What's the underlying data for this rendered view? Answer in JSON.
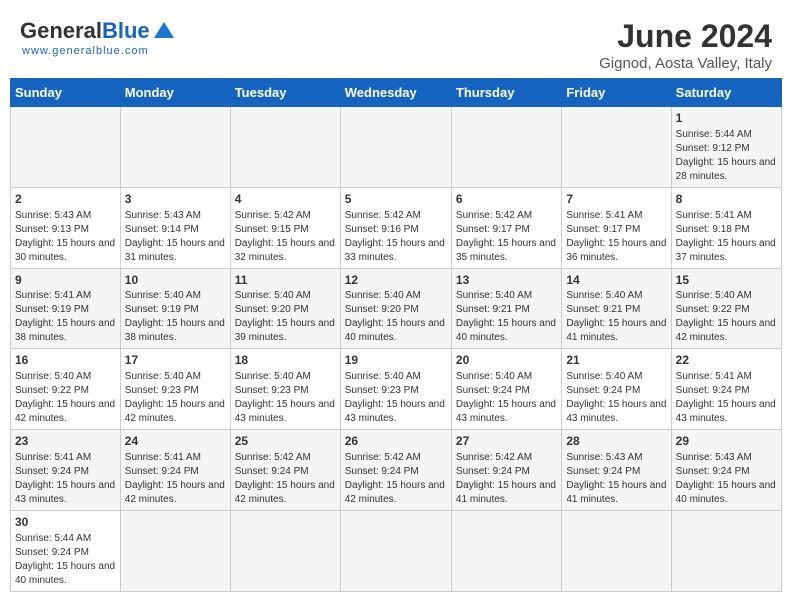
{
  "header": {
    "logo_general": "General",
    "logo_blue": "Blue",
    "logo_tagline": "www.generalblue.com",
    "month_title": "June 2024",
    "location": "Gignod, Aosta Valley, Italy"
  },
  "weekdays": [
    "Sunday",
    "Monday",
    "Tuesday",
    "Wednesday",
    "Thursday",
    "Friday",
    "Saturday"
  ],
  "days": {
    "d1": {
      "num": "1",
      "sunrise": "5:44 AM",
      "sunset": "9:12 PM",
      "daylight": "15 hours and 28 minutes."
    },
    "d2": {
      "num": "2",
      "sunrise": "5:43 AM",
      "sunset": "9:13 PM",
      "daylight": "15 hours and 30 minutes."
    },
    "d3": {
      "num": "3",
      "sunrise": "5:43 AM",
      "sunset": "9:14 PM",
      "daylight": "15 hours and 31 minutes."
    },
    "d4": {
      "num": "4",
      "sunrise": "5:42 AM",
      "sunset": "9:15 PM",
      "daylight": "15 hours and 32 minutes."
    },
    "d5": {
      "num": "5",
      "sunrise": "5:42 AM",
      "sunset": "9:16 PM",
      "daylight": "15 hours and 33 minutes."
    },
    "d6": {
      "num": "6",
      "sunrise": "5:42 AM",
      "sunset": "9:17 PM",
      "daylight": "15 hours and 35 minutes."
    },
    "d7": {
      "num": "7",
      "sunrise": "5:41 AM",
      "sunset": "9:17 PM",
      "daylight": "15 hours and 36 minutes."
    },
    "d8": {
      "num": "8",
      "sunrise": "5:41 AM",
      "sunset": "9:18 PM",
      "daylight": "15 hours and 37 minutes."
    },
    "d9": {
      "num": "9",
      "sunrise": "5:41 AM",
      "sunset": "9:19 PM",
      "daylight": "15 hours and 38 minutes."
    },
    "d10": {
      "num": "10",
      "sunrise": "5:40 AM",
      "sunset": "9:19 PM",
      "daylight": "15 hours and 38 minutes."
    },
    "d11": {
      "num": "11",
      "sunrise": "5:40 AM",
      "sunset": "9:20 PM",
      "daylight": "15 hours and 39 minutes."
    },
    "d12": {
      "num": "12",
      "sunrise": "5:40 AM",
      "sunset": "9:20 PM",
      "daylight": "15 hours and 40 minutes."
    },
    "d13": {
      "num": "13",
      "sunrise": "5:40 AM",
      "sunset": "9:21 PM",
      "daylight": "15 hours and 40 minutes."
    },
    "d14": {
      "num": "14",
      "sunrise": "5:40 AM",
      "sunset": "9:21 PM",
      "daylight": "15 hours and 41 minutes."
    },
    "d15": {
      "num": "15",
      "sunrise": "5:40 AM",
      "sunset": "9:22 PM",
      "daylight": "15 hours and 42 minutes."
    },
    "d16": {
      "num": "16",
      "sunrise": "5:40 AM",
      "sunset": "9:22 PM",
      "daylight": "15 hours and 42 minutes."
    },
    "d17": {
      "num": "17",
      "sunrise": "5:40 AM",
      "sunset": "9:23 PM",
      "daylight": "15 hours and 42 minutes."
    },
    "d18": {
      "num": "18",
      "sunrise": "5:40 AM",
      "sunset": "9:23 PM",
      "daylight": "15 hours and 43 minutes."
    },
    "d19": {
      "num": "19",
      "sunrise": "5:40 AM",
      "sunset": "9:23 PM",
      "daylight": "15 hours and 43 minutes."
    },
    "d20": {
      "num": "20",
      "sunrise": "5:40 AM",
      "sunset": "9:24 PM",
      "daylight": "15 hours and 43 minutes."
    },
    "d21": {
      "num": "21",
      "sunrise": "5:40 AM",
      "sunset": "9:24 PM",
      "daylight": "15 hours and 43 minutes."
    },
    "d22": {
      "num": "22",
      "sunrise": "5:41 AM",
      "sunset": "9:24 PM",
      "daylight": "15 hours and 43 minutes."
    },
    "d23": {
      "num": "23",
      "sunrise": "5:41 AM",
      "sunset": "9:24 PM",
      "daylight": "15 hours and 43 minutes."
    },
    "d24": {
      "num": "24",
      "sunrise": "5:41 AM",
      "sunset": "9:24 PM",
      "daylight": "15 hours and 42 minutes."
    },
    "d25": {
      "num": "25",
      "sunrise": "5:42 AM",
      "sunset": "9:24 PM",
      "daylight": "15 hours and 42 minutes."
    },
    "d26": {
      "num": "26",
      "sunrise": "5:42 AM",
      "sunset": "9:24 PM",
      "daylight": "15 hours and 42 minutes."
    },
    "d27": {
      "num": "27",
      "sunrise": "5:42 AM",
      "sunset": "9:24 PM",
      "daylight": "15 hours and 41 minutes."
    },
    "d28": {
      "num": "28",
      "sunrise": "5:43 AM",
      "sunset": "9:24 PM",
      "daylight": "15 hours and 41 minutes."
    },
    "d29": {
      "num": "29",
      "sunrise": "5:43 AM",
      "sunset": "9:24 PM",
      "daylight": "15 hours and 40 minutes."
    },
    "d30": {
      "num": "30",
      "sunrise": "5:44 AM",
      "sunset": "9:24 PM",
      "daylight": "15 hours and 40 minutes."
    }
  },
  "labels": {
    "sunrise": "Sunrise:",
    "sunset": "Sunset:",
    "daylight": "Daylight:"
  }
}
